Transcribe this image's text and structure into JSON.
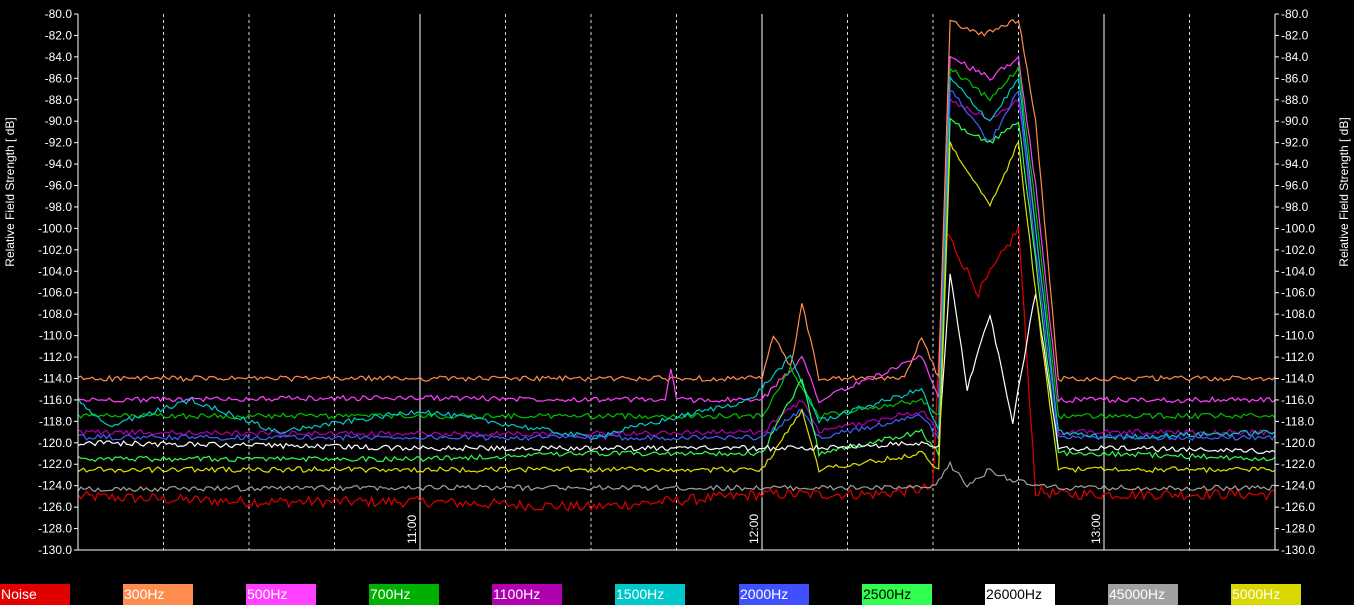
{
  "chart_data": {
    "type": "line",
    "title": "",
    "xlabel": "",
    "ylabel": "Relative Field Strength [ dB]",
    "ylim": [
      -130,
      -80
    ],
    "ytick_step": 2,
    "xlim": [
      "10:00",
      "13:30"
    ],
    "x_tick_labels": [
      "11:00",
      "12:00",
      "13:00"
    ],
    "grid": true,
    "legend_position": "bottom",
    "series": [
      {
        "name": "Noise",
        "color": "#e00000",
        "swatch": "#e00000",
        "text_color": "#ffffff",
        "x": [
          "10:00",
          "10:30",
          "11:00",
          "11:30",
          "12:00",
          "12:20",
          "12:30",
          "12:32",
          "12:38",
          "12:45",
          "12:48",
          "12:52",
          "13:00",
          "13:30"
        ],
        "values": [
          -125.0,
          -125.5,
          -125.5,
          -126.0,
          -124.8,
          -124.8,
          -124.2,
          -100,
          -106,
          -100,
          -124.5,
          -124.8,
          -124.8,
          -124.8
        ]
      },
      {
        "name": "300Hz",
        "color": "#ff8c4f",
        "swatch": "#ff8c4f",
        "text_color": "#ffffff",
        "x": [
          "10:00",
          "11:00",
          "11:50",
          "12:00",
          "12:02",
          "12:05",
          "12:07",
          "12:10",
          "12:25",
          "12:28",
          "12:31",
          "12:33",
          "12:38",
          "12:45",
          "12:48",
          "12:52",
          "13:00",
          "13:30"
        ],
        "values": [
          -114.0,
          -114.0,
          -114.0,
          -114.0,
          -110.0,
          -113.0,
          -107.0,
          -114.0,
          -114.0,
          -110.0,
          -114.0,
          -80.5,
          -82.0,
          -80.5,
          -90.0,
          -114.0,
          -114.0,
          -114.0
        ]
      },
      {
        "name": "500Hz",
        "color": "#ff40ff",
        "swatch": "#ff40ff",
        "text_color": "#ffffff",
        "x": [
          "10:00",
          "11:00",
          "11:43",
          "11:44",
          "11:45",
          "12:00",
          "12:07",
          "12:10",
          "12:28",
          "12:31",
          "12:33",
          "12:40",
          "12:45",
          "12:48",
          "12:52",
          "13:00",
          "13:30"
        ],
        "values": [
          -116.0,
          -115.8,
          -116.0,
          -113.0,
          -116.0,
          -116.0,
          -112.0,
          -116.0,
          -112.0,
          -116.0,
          -84.0,
          -86.0,
          -84.0,
          -96.0,
          -116.0,
          -116.0,
          -116.0
        ]
      },
      {
        "name": "700Hz",
        "color": "#00c000",
        "swatch": "#00b000",
        "text_color": "#ffffff",
        "x": [
          "10:00",
          "11:00",
          "12:00",
          "12:05",
          "12:10",
          "12:28",
          "12:31",
          "12:33",
          "12:40",
          "12:45",
          "12:48",
          "12:52",
          "13:00",
          "13:30"
        ],
        "values": [
          -117.5,
          -117.5,
          -117.5,
          -113.0,
          -117.5,
          -116.0,
          -117.5,
          -85.0,
          -88.0,
          -85.0,
          -98.0,
          -117.5,
          -117.5,
          -117.5
        ]
      },
      {
        "name": "1100Hz",
        "color": "#b000b0",
        "swatch": "#b000b0",
        "text_color": "#ffffff",
        "x": [
          "10:00",
          "11:00",
          "12:00",
          "12:07",
          "12:10",
          "12:28",
          "12:31",
          "12:33",
          "12:40",
          "12:45",
          "12:48",
          "12:52",
          "13:00",
          "13:30"
        ],
        "values": [
          -119.0,
          -119.2,
          -119.0,
          -116.0,
          -119.0,
          -117.0,
          -119.0,
          -88.0,
          -90.0,
          -88.0,
          -100.0,
          -119.0,
          -119.0,
          -119.0
        ]
      },
      {
        "name": "1500Hz",
        "color": "#00c8c8",
        "swatch": "#00c8c8",
        "text_color": "#ffffff",
        "x": [
          "10:00",
          "10:05",
          "10:20",
          "10:35",
          "11:00",
          "11:30",
          "11:58",
          "12:05",
          "12:10",
          "12:28",
          "12:31",
          "12:33",
          "12:40",
          "12:45",
          "12:48",
          "12:52",
          "13:00",
          "13:30"
        ],
        "values": [
          -116.0,
          -118.5,
          -116.0,
          -119.0,
          -117.0,
          -119.5,
          -116.0,
          -112.0,
          -118.0,
          -115.0,
          -119.0,
          -86.0,
          -90.0,
          -86.0,
          -100.0,
          -119.0,
          -119.5,
          -119.0
        ]
      },
      {
        "name": "2000Hz",
        "color": "#4060ff",
        "swatch": "#4050ff",
        "text_color": "#ffffff",
        "x": [
          "10:00",
          "11:00",
          "12:00",
          "12:07",
          "12:10",
          "12:28",
          "12:31",
          "12:33",
          "12:40",
          "12:45",
          "12:48",
          "12:52",
          "13:00",
          "13:30"
        ],
        "values": [
          -119.5,
          -119.5,
          -119.5,
          -117.0,
          -119.5,
          -117.5,
          -119.5,
          -87.0,
          -92.0,
          -87.0,
          -102.0,
          -119.5,
          -119.5,
          -119.5
        ]
      },
      {
        "name": "2500Hz",
        "color": "#30ff50",
        "swatch": "#30ff50",
        "text_color": "#000000",
        "x": [
          "10:00",
          "11:00",
          "11:30",
          "12:00",
          "12:07",
          "12:10",
          "12:28",
          "12:31",
          "12:33",
          "12:40",
          "12:45",
          "12:48",
          "12:52",
          "13:00",
          "13:30"
        ],
        "values": [
          -121.5,
          -121.5,
          -121.0,
          -121.0,
          -114.0,
          -121.0,
          -119.0,
          -121.0,
          -90.0,
          -92.0,
          -90.0,
          -103.0,
          -121.0,
          -121.0,
          -121.5
        ]
      },
      {
        "name": "26000Hz",
        "color": "#ffffff",
        "swatch": "#ffffff",
        "text_color": "#000000",
        "x": [
          "10:00",
          "11:00",
          "12:00",
          "12:10",
          "12:28",
          "12:31",
          "12:33",
          "12:36",
          "12:40",
          "12:44",
          "12:48",
          "12:52",
          "13:00",
          "13:30"
        ],
        "values": [
          -120.0,
          -120.5,
          -120.5,
          -120.5,
          -120.0,
          -120.5,
          -104.0,
          -115.0,
          -108.0,
          -118.0,
          -106.0,
          -120.5,
          -120.5,
          -120.8
        ]
      },
      {
        "name": "45000Hz",
        "color": "#a0a0a0",
        "swatch": "#a0a0a0",
        "text_color": "#ffffff",
        "x": [
          "10:00",
          "11:00",
          "12:00",
          "12:30",
          "12:33",
          "12:36",
          "12:40",
          "12:44",
          "12:48",
          "12:52",
          "13:00",
          "13:30"
        ],
        "values": [
          -124.3,
          -124.2,
          -124.2,
          -124.2,
          -122.0,
          -124.0,
          -122.5,
          -123.5,
          -124.0,
          -124.2,
          -124.2,
          -124.2
        ]
      },
      {
        "name": "5000Hz",
        "color": "#e0e000",
        "swatch": "#d8d800",
        "text_color": "#ffffff",
        "x": [
          "10:00",
          "11:00",
          "12:00",
          "12:07",
          "12:10",
          "12:28",
          "12:31",
          "12:33",
          "12:40",
          "12:45",
          "12:48",
          "12:52",
          "13:00",
          "13:30"
        ],
        "values": [
          -122.5,
          -122.5,
          -122.5,
          -117.0,
          -122.5,
          -121.0,
          -122.5,
          -92.0,
          -98.0,
          -92.0,
          -106.0,
          -122.5,
          -122.5,
          -122.5
        ]
      }
    ]
  }
}
